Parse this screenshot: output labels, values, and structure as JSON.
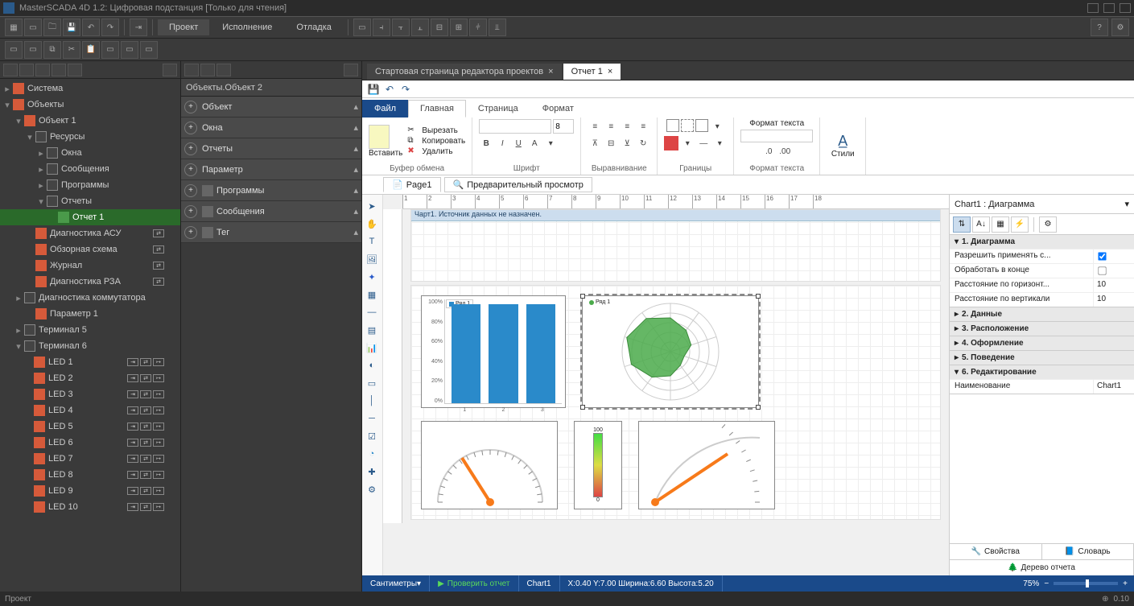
{
  "app": {
    "title": "MasterSCADA 4D 1.2: Цифровая подстанция [Только для чтения]",
    "status_left": "Проект",
    "status_zoom_btn": "⊕",
    "status_zoom_val": "0.10"
  },
  "main_tabs": {
    "t1": "Проект",
    "t2": "Исполнение",
    "t3": "Отладка"
  },
  "tree": {
    "system": "Система",
    "objects": "Объекты",
    "object1": "Объект 1",
    "resources": "Ресурсы",
    "windows": "Окна",
    "messages": "Сообщения",
    "programs": "Программы",
    "reports": "Отчеты",
    "report1": "Отчет 1",
    "diagACU": "Диагностика АСУ",
    "overview": "Обзорная схема",
    "journal": "Журнал",
    "diagRZA": "Диагностика РЗА",
    "diagComm": "Диагностика коммутатора",
    "param1": "Параметр 1",
    "term5": "Терминал 5",
    "term6": "Терминал 6",
    "led1": "LED 1",
    "led2": "LED 2",
    "led3": "LED 3",
    "led4": "LED 4",
    "led5": "LED 5",
    "led6": "LED 6",
    "led7": "LED 7",
    "led8": "LED 8",
    "led9": "LED 9",
    "led10": "LED 10"
  },
  "middle": {
    "header": "Объекты.Объект 2",
    "c_object": "Объект",
    "c_windows": "Окна",
    "c_reports": "Отчеты",
    "c_param": "Параметр",
    "c_programs": "Программы",
    "c_messages": "Сообщения",
    "c_tag": "Тег"
  },
  "doc_tabs": {
    "start": "Стартовая страница редактора проектов",
    "report": "Отчет 1"
  },
  "ribbon": {
    "file": "Файл",
    "home": "Главная",
    "page": "Страница",
    "format": "Формат",
    "paste": "Вставить",
    "cut": "Вырезать",
    "copy": "Копировать",
    "delete": "Удалить",
    "g_clipboard": "Буфер обмена",
    "g_font": "Шрифт",
    "g_align": "Выравнивание",
    "g_borders": "Границы",
    "g_textfmt": "Формат текста",
    "styles": "Стили",
    "fmt_text": "Формат текста",
    "font_name": "",
    "font_size": "8"
  },
  "page_tabs": {
    "page1": "Page1",
    "preview": "Предварительный просмотр"
  },
  "band": {
    "header": "Чарт1. Источник данных не назначен."
  },
  "ruler_ticks": [
    "1",
    "2",
    "3",
    "4",
    "5",
    "6",
    "7",
    "8",
    "9",
    "10",
    "11",
    "12",
    "13",
    "14",
    "15",
    "16",
    "17",
    "18"
  ],
  "chart_data": [
    {
      "type": "bar",
      "title": "",
      "series_label": "Ряд 1",
      "categories": [
        "1",
        "2",
        "3"
      ],
      "values": [
        95,
        95,
        95
      ],
      "ylim": [
        0,
        100
      ],
      "y_ticks": [
        "100%",
        "80%",
        "60%",
        "40%",
        "20%",
        "0%"
      ]
    },
    {
      "type": "radar",
      "series_label": "Ряд 1",
      "axes_count": 10,
      "values_norm": [
        0.7,
        0.55,
        0.45,
        0.3,
        0.35,
        0.5,
        0.65,
        0.85,
        0.95,
        0.85
      ]
    },
    {
      "type": "gauge",
      "min": 0,
      "max": 100,
      "value": 35,
      "tick_major": 10
    },
    {
      "type": "linear_gauge",
      "min": 0,
      "max": 100,
      "value": 70
    },
    {
      "type": "gauge_quarter",
      "min": 0,
      "max": 100,
      "value": 40
    }
  ],
  "props": {
    "header": "Chart1 : Диаграмма",
    "s1": "1. Диаграмма",
    "s1_allow": "Разрешить применять с...",
    "s1_end": "Обработать в конце",
    "s1_hgap": "Расстояние по горизонт...",
    "s1_vgap": "Расстояние по вертикали",
    "s1_hgap_v": "10",
    "s1_vgap_v": "10",
    "s2": "2. Данные",
    "s3": "3. Расположение",
    "s4": "4. Оформление",
    "s5": "5. Поведение",
    "s6": "6. Редактирование",
    "s6_name": "Наименование",
    "s6_name_v": "Chart1",
    "tab_props": "Свойства",
    "tab_dict": "Словарь",
    "tab_tree": "Дерево отчета"
  },
  "editor_status": {
    "units": "Сантиметры",
    "check": "Проверить отчет",
    "selection": "Chart1",
    "coords": "X:0.40  Y:7.00  Ширина:6.60  Высота:5.20",
    "zoom": "75%"
  }
}
